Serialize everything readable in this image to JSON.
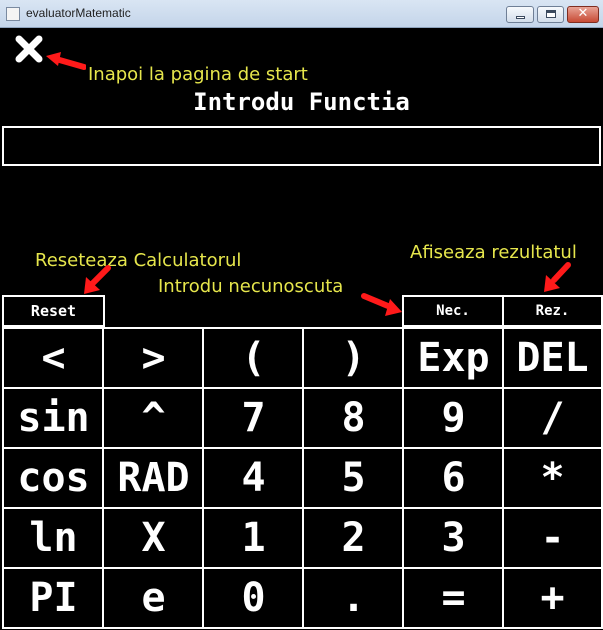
{
  "window": {
    "title": "evaluatorMatematic",
    "icon": "app-icon"
  },
  "header": {
    "back_icon": "close-x-icon",
    "back_annotation": "Inapoi la pagina de start",
    "title": "Introdu Functia"
  },
  "function_input": {
    "value": "",
    "placeholder": ""
  },
  "annotations": {
    "reset": "Reseteaza Calculatorul",
    "unknown": "Introdu necunoscuta",
    "result": "Afiseaza rezultatul"
  },
  "buttons": {
    "reset": "Reset",
    "nec": "Nec.",
    "rez": "Rez."
  },
  "keys": [
    [
      "<",
      ">",
      "(",
      ")",
      "Exp",
      "DEL"
    ],
    [
      "sin",
      "^",
      "7",
      "8",
      "9",
      "/"
    ],
    [
      "cos",
      "RAD",
      "4",
      "5",
      "6",
      "*"
    ],
    [
      "ln",
      "X",
      "1",
      "2",
      "3",
      "-"
    ],
    [
      "PI",
      "e",
      "0",
      ".",
      "=",
      "+"
    ]
  ],
  "colors": {
    "annotation": "#e6e64c",
    "arrow": "#ff1a1a",
    "background": "#000000",
    "foreground": "#ffffff"
  }
}
